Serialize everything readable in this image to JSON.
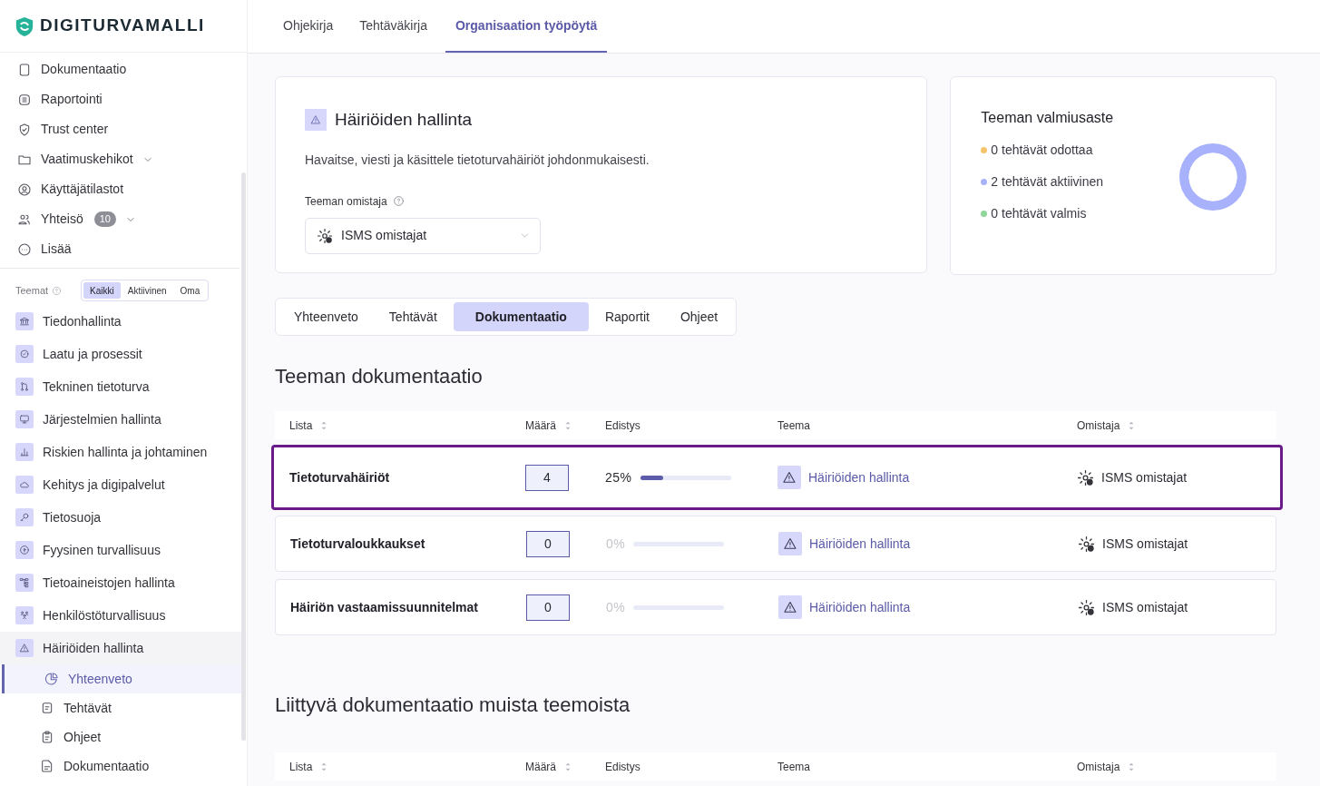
{
  "brand": {
    "name": "DIGITURVAMALLI"
  },
  "top_tabs": [
    {
      "label": "Ohjekirja",
      "selected": false
    },
    {
      "label": "Tehtäväkirja",
      "selected": false
    },
    {
      "label": "Organisaation työpöytä",
      "selected": true
    }
  ],
  "sidebar": {
    "nav_items": [
      {
        "label": "Dokumentaatio",
        "expandable": false
      },
      {
        "label": "Raportointi",
        "expandable": false
      },
      {
        "label": "Trust center",
        "expandable": false
      },
      {
        "label": "Vaatimuskehikot",
        "expandable": true
      },
      {
        "label": "Käyttäjätilastot",
        "expandable": false
      },
      {
        "label": "Yhteisö",
        "badge": "10",
        "expandable": true
      },
      {
        "label": "Lisää",
        "expandable": false
      }
    ],
    "themes_label": "Teemat",
    "theme_filter": [
      {
        "label": "Kaikki",
        "selected": true
      },
      {
        "label": "Aktiivinen",
        "selected": false
      },
      {
        "label": "Oma",
        "selected": false
      }
    ],
    "themes": [
      {
        "label": "Tiedonhallinta"
      },
      {
        "label": "Laatu ja prosessit"
      },
      {
        "label": "Tekninen tietoturva"
      },
      {
        "label": "Järjestelmien hallinta"
      },
      {
        "label": "Riskien hallinta ja johtaminen"
      },
      {
        "label": "Kehitys ja digipalvelut"
      },
      {
        "label": "Tietosuoja"
      },
      {
        "label": "Fyysinen turvallisuus"
      },
      {
        "label": "Tietoaineistojen hallinta"
      },
      {
        "label": "Henkilöstöturvallisuus"
      },
      {
        "label": "Häiriöiden hallinta",
        "children": [
          {
            "label": "Yhteenveto",
            "selected": true
          },
          {
            "label": "Tehtävät",
            "selected": false
          },
          {
            "label": "Ohjeet",
            "selected": false
          },
          {
            "label": "Dokumentaatio",
            "selected": false
          }
        ]
      }
    ]
  },
  "theme_card": {
    "title": "Häiriöiden hallinta",
    "description": "Havaitse, viesti ja käsittele tietoturvahäiriöt johdonmukaisesti.",
    "owner_label": "Teeman omistaja",
    "owner_value": "ISMS omistajat"
  },
  "readiness_card": {
    "title": "Teeman valmiusaste",
    "legend": [
      {
        "color": "#f6c46b"
      },
      {
        "color": "#a8b1fb"
      },
      {
        "color": "#8fd69a"
      }
    ],
    "chart_data": {
      "type": "donut",
      "categories": [
        "0 tehtävät odottaa",
        "2 tehtävät aktiivinen",
        "0 tehtävät valmis"
      ],
      "values": [
        0,
        2,
        0
      ]
    }
  },
  "content_tabs": [
    {
      "label": "Yhteenveto",
      "selected": false
    },
    {
      "label": "Tehtävät",
      "selected": false
    },
    {
      "label": "Dokumentaatio",
      "selected": true
    },
    {
      "label": "Raportit",
      "selected": false
    },
    {
      "label": "Ohjeet",
      "selected": false
    }
  ],
  "doc_section": {
    "title": "Teeman dokumentaatio",
    "columns": [
      {
        "label": "Lista",
        "sortable": true
      },
      {
        "label": "Määrä",
        "sortable": true
      },
      {
        "label": "Edistys",
        "sortable": false
      },
      {
        "label": "Teema",
        "sortable": false
      },
      {
        "label": "Omistaja",
        "sortable": true
      }
    ],
    "rows": [
      {
        "name": "Tietoturvahäiriöt",
        "count": "4",
        "progress": "25%",
        "level": 0.25,
        "theme": "Häiriöiden hallinta",
        "owner": "ISMS omistajat",
        "highlighted": true
      },
      {
        "name": "Tietoturvaloukkaukset",
        "count": "0",
        "progress": "0%",
        "level": 0,
        "theme": "Häiriöiden hallinta",
        "owner": "ISMS omistajat",
        "highlighted": false
      },
      {
        "name": "Häiriön vastaamissuunnitelmat",
        "count": "0",
        "progress": "0%",
        "level": 0,
        "theme": "Häiriöiden hallinta",
        "owner": "ISMS omistajat",
        "highlighted": false
      }
    ]
  },
  "related_section": {
    "title": "Liittyvä dokumentaatio muista teemoista",
    "columns": [
      {
        "label": "Lista",
        "sortable": true
      },
      {
        "label": "Määrä",
        "sortable": true
      },
      {
        "label": "Edistys",
        "sortable": false
      },
      {
        "label": "Teema",
        "sortable": false
      },
      {
        "label": "Omistaja",
        "sortable": true
      }
    ]
  }
}
